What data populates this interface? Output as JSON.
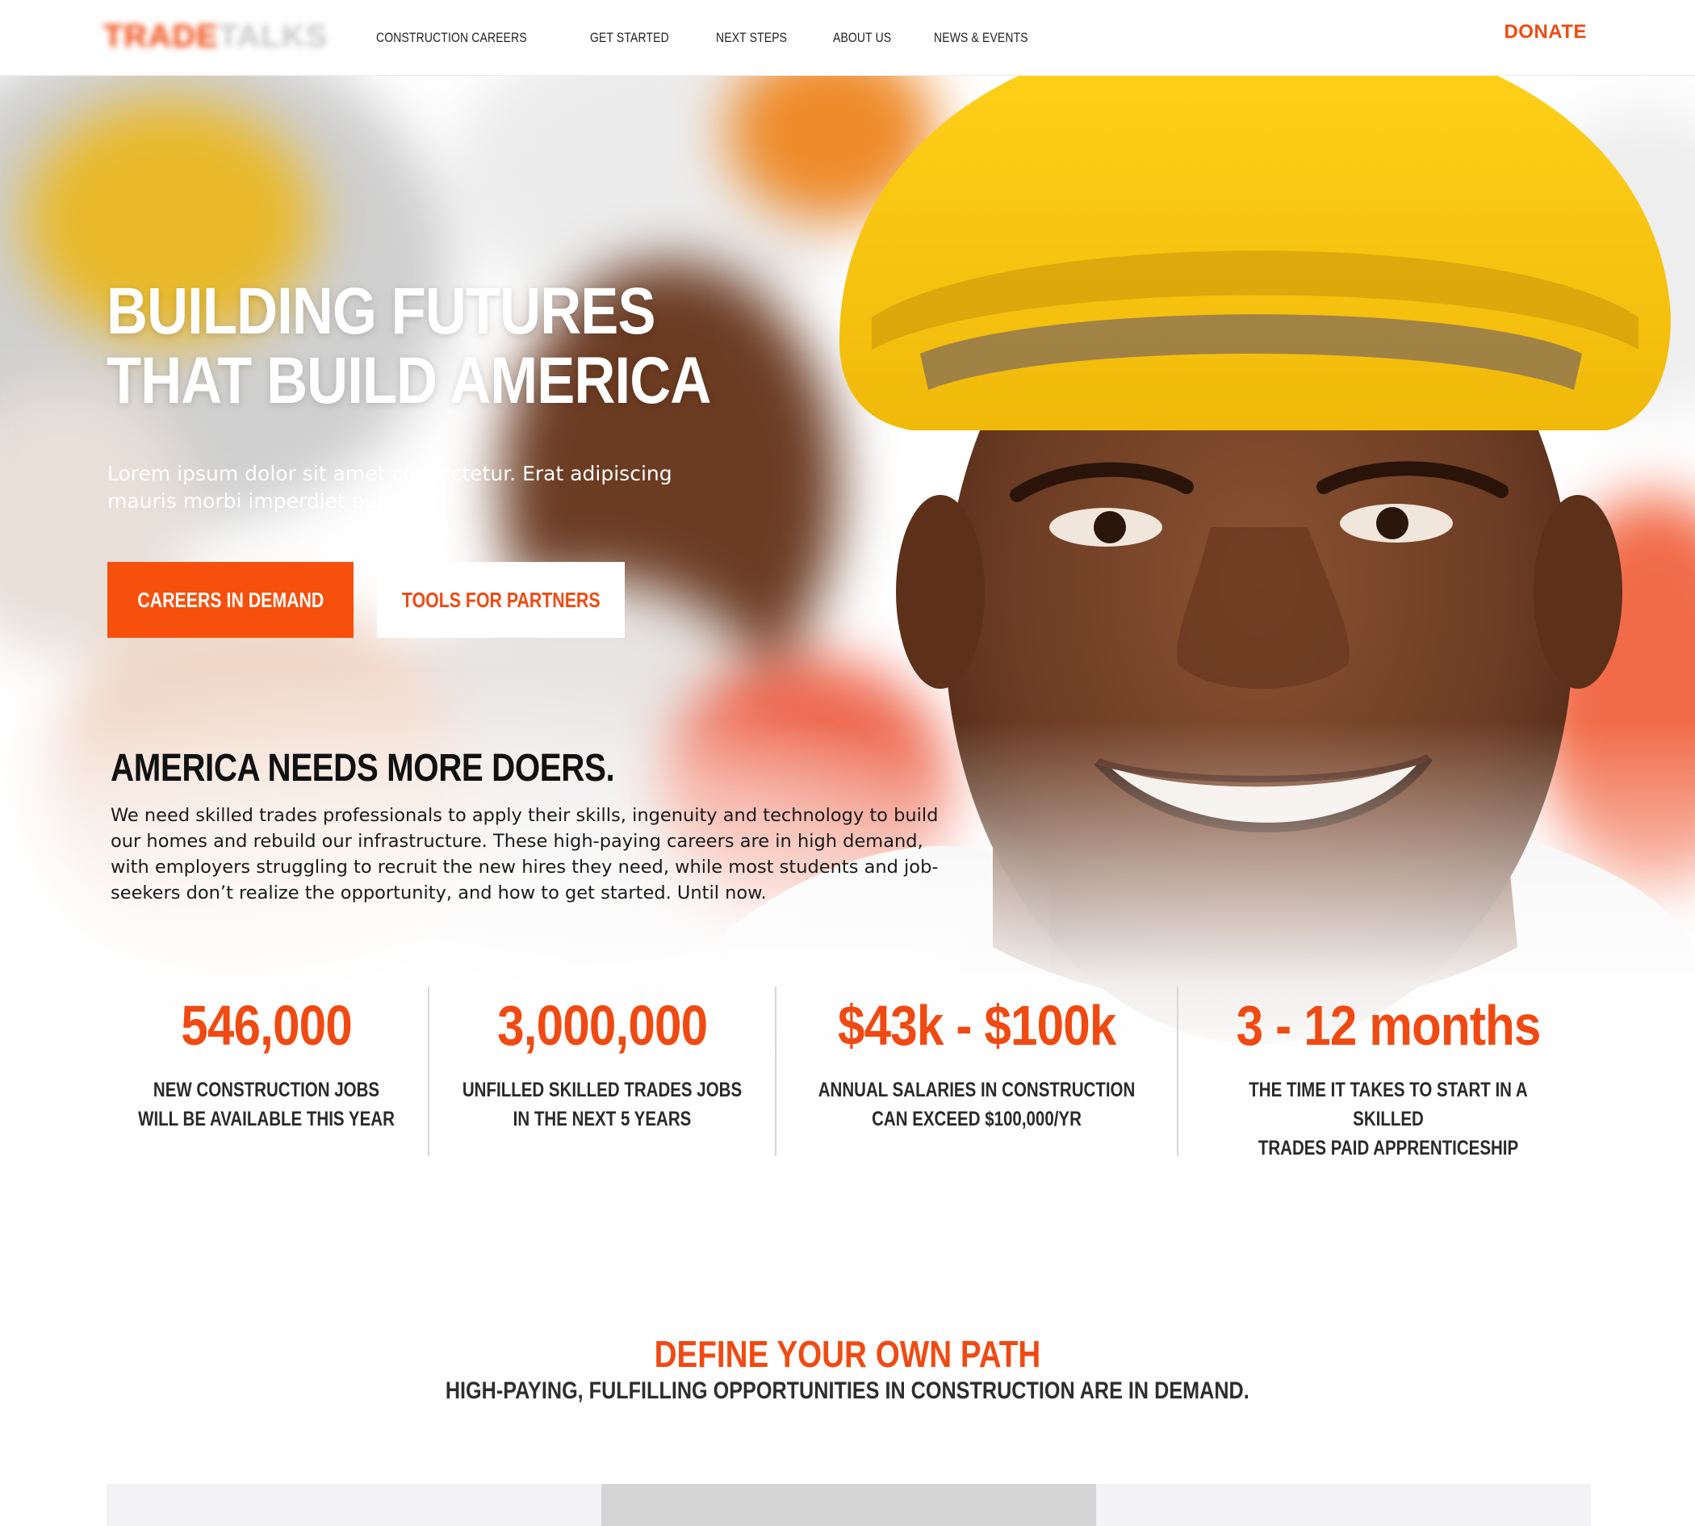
{
  "brand": {
    "logo_part1": "TRADE",
    "logo_part2": "TALKS",
    "accent_color": "#f04a12"
  },
  "nav": {
    "items": [
      {
        "label": "CONSTRUCTION CAREERS"
      },
      {
        "label": "GET STARTED"
      },
      {
        "label": "NEXT STEPS"
      },
      {
        "label": "ABOUT US"
      },
      {
        "label": "NEWS & EVENTS"
      }
    ],
    "donate_label": "DONATE"
  },
  "hero": {
    "title_line1": "BUILDING FUTURES",
    "title_line2": "THAT BUILD AMERICA",
    "lead": "Lorem ipsum dolor sit amet consectetur. Erat adipiscing mauris morbi imperdiet pulvinar.",
    "primary_button": "CAREERS IN DEMAND",
    "secondary_button": "TOOLS FOR PARTNERS",
    "image": "smiling-construction-worker-yellow-hard-hat"
  },
  "intro": {
    "heading": "AMERICA NEEDS MORE DOERS.",
    "body": "We need skilled trades professionals to apply their skills, ingenuity and technology to build our homes and rebuild our infrastructure. These high-paying careers are in high demand, with employers struggling to recruit the new hires they need, while most students and job-seekers don’t realize the opportunity, and how to get started. Until now."
  },
  "stats": [
    {
      "value": "546,000",
      "label": "NEW CONSTRUCTION JOBS\nWILL BE AVAILABLE THIS YEAR"
    },
    {
      "value": "3,000,000",
      "label": "UNFILLED SKILLED TRADES JOBS\nIN THE NEXT 5 YEARS"
    },
    {
      "value": "$43k - $100k",
      "label": "ANNUAL SALARIES IN CONSTRUCTION\nCAN EXCEED $100,000/YR"
    },
    {
      "value": "3 - 12 months",
      "label": "THE TIME IT TAKES TO START IN A SKILLED\nTRADES PAID APPRENTICESHIP"
    }
  ],
  "path": {
    "title": "DEFINE YOUR OWN PATH",
    "subtitle": "HIGH-PAYING, FULFILLING OPPORTUNITIES IN CONSTRUCTION ARE IN DEMAND."
  }
}
